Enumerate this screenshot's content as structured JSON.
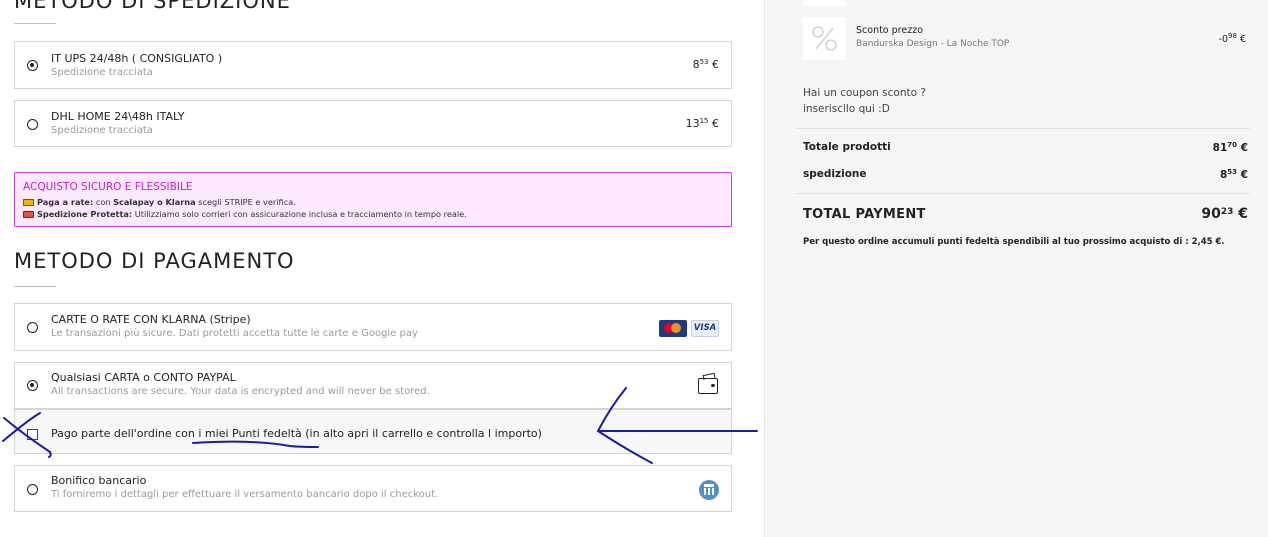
{
  "shipping": {
    "title": "METODO DI SPEDIZIONE",
    "options": [
      {
        "name": "IT UPS 24/48h ( CONSIGLIATO )",
        "desc": "Spedizione tracciata",
        "price_int": "8",
        "price_dec": "53",
        "currency": "€",
        "selected": true
      },
      {
        "name": "DHL HOME 24\\48h ITALY",
        "desc": "Spedizione tracciata",
        "price_int": "13",
        "price_dec": "15",
        "currency": "€",
        "selected": false
      }
    ]
  },
  "promo": {
    "title": "ACQUISTO SICURO E FLESSIBILE",
    "line1_bold": "Paga a rate:",
    "line1_a": " con ",
    "line1_b": "Scalapay o Klarna",
    "line1_c": " scegli STRIPE e verifica.",
    "line2_bold": "Spedizione Protetta:",
    "line2_rest": " Utilizziamo solo corrieri con assicurazione inclusa e tracciamento in tempo reale.",
    "colors": {
      "border": "#d33ce0",
      "background": "#fde9ff",
      "title": "#c21bcf"
    }
  },
  "payment": {
    "title": "METODO DI PAGAMENTO",
    "options": [
      {
        "name": "CARTE O RATE CON KLARNA (Stripe)",
        "desc": "Le transazioni più sicure. Dati protetti accetta tutte le carte e Google pay",
        "selected": false,
        "icons": [
          "mastercard-icon",
          "visa-icon"
        ]
      },
      {
        "name": "Qualsiasi CARTA o CONTO PAYPAL",
        "desc": "All transactions are secure. Your data is encrypted and will never be stored.",
        "selected": true,
        "icons": [
          "wallet-icon"
        ]
      },
      {
        "name": "Bonifico bancario",
        "desc": "Ti forniremo i dettagli per effettuare il versamento bancario dopo il checkout.",
        "selected": false,
        "icons": [
          "bank-icon"
        ]
      }
    ],
    "points_checkbox": {
      "label": "Pago parte dell'ordine con i miei Punti fedeltà (in alto apri il carrello e controlla l importo)",
      "checked": false
    }
  },
  "summary": {
    "discount": {
      "label": "Sconto prezzo",
      "product": "Bandurska Design - La Noche TOP",
      "price_int": "-0",
      "price_dec": "98",
      "currency": "€"
    },
    "coupon_line1": "Hai un coupon sconto ?",
    "coupon_line2": "inseriscilo qui :D",
    "totals": [
      {
        "label": "Totale prodotti",
        "price_int": "81",
        "price_dec": "70",
        "currency": "€"
      },
      {
        "label": "spedizione",
        "price_int": "8",
        "price_dec": "53",
        "currency": "€"
      }
    ],
    "total": {
      "label": "TOTAL PAYMENT",
      "price_int": "90",
      "price_dec": "23",
      "currency": "€"
    },
    "points_note": "Per questo ordine accumuli punti fedeltà spendibili al tuo prossimo acquisto di : 2,45 €."
  },
  "annotation": {
    "color": "#1a1aa8",
    "icons": [
      "cross-mark-icon",
      "underline-mark",
      "arrow-left-icon"
    ]
  }
}
